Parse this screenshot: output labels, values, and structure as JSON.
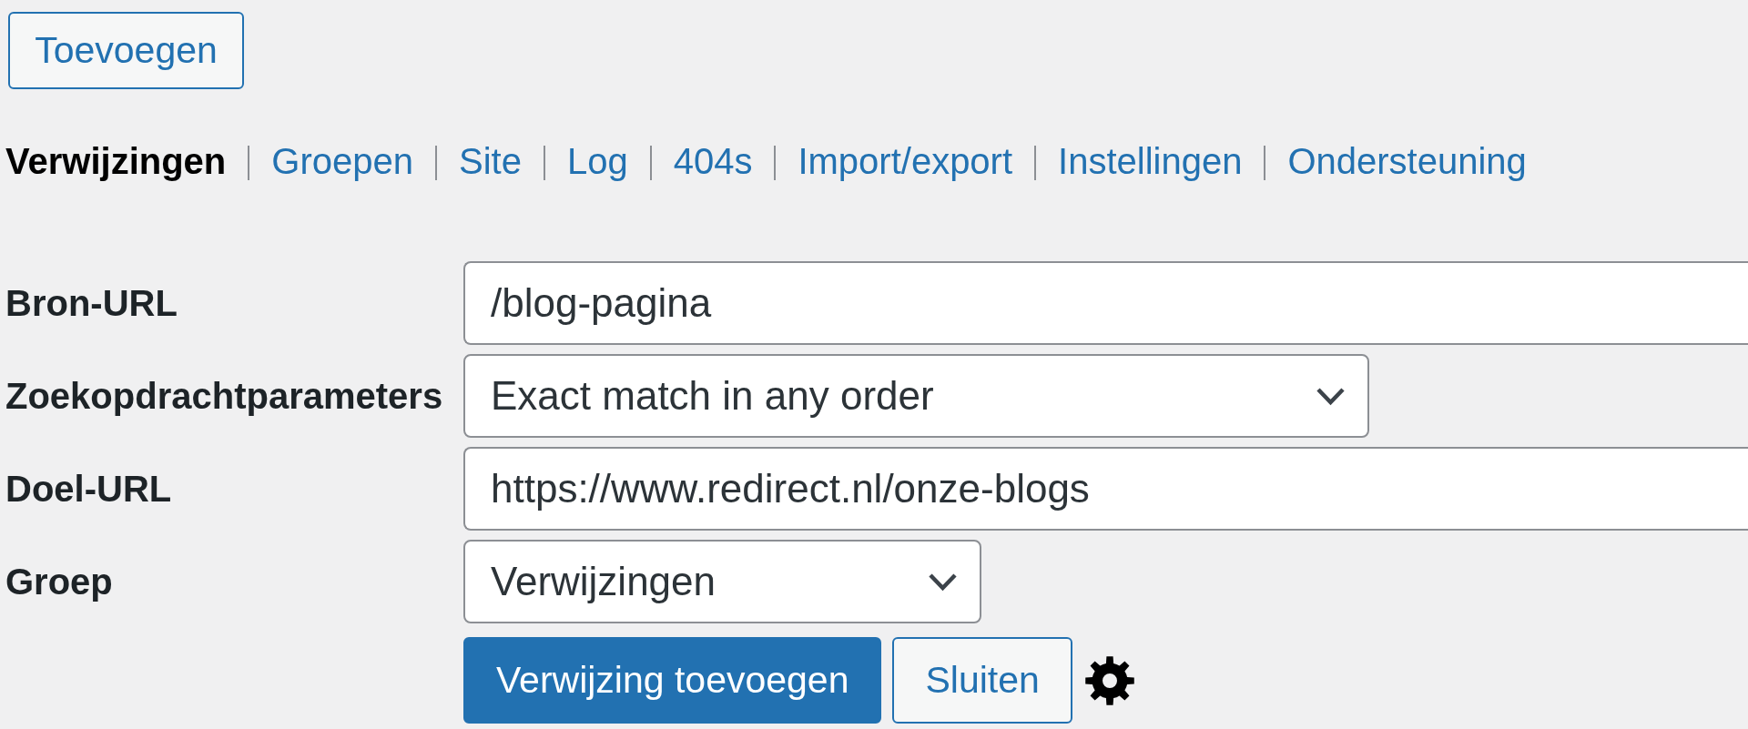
{
  "add_button": {
    "label": "Toevoegen"
  },
  "nav": [
    {
      "label": "Verwijzingen",
      "selected": true
    },
    {
      "label": "Groepen",
      "selected": false
    },
    {
      "label": "Site",
      "selected": false
    },
    {
      "label": "Log",
      "selected": false
    },
    {
      "label": "404s",
      "selected": false
    },
    {
      "label": "Import/export",
      "selected": false
    },
    {
      "label": "Instellingen",
      "selected": false
    },
    {
      "label": "Ondersteuning",
      "selected": false
    }
  ],
  "form": {
    "fields": [
      {
        "label": "Bron-URL",
        "kind": "text",
        "value": "/blog-pagina"
      },
      {
        "label": "Zoekopdrachtparameters",
        "kind": "select",
        "value": "Exact match in any order"
      },
      {
        "label": "Doel-URL",
        "kind": "text",
        "value": "https://www.redirect.nl/onze-blogs"
      },
      {
        "label": "Groep",
        "kind": "select",
        "value": "Verwijzingen"
      }
    ]
  },
  "actions": [
    {
      "label": "Verwijzing toevoegen",
      "kind": "primary"
    },
    {
      "label": "Sluiten",
      "kind": "secondary"
    }
  ]
}
